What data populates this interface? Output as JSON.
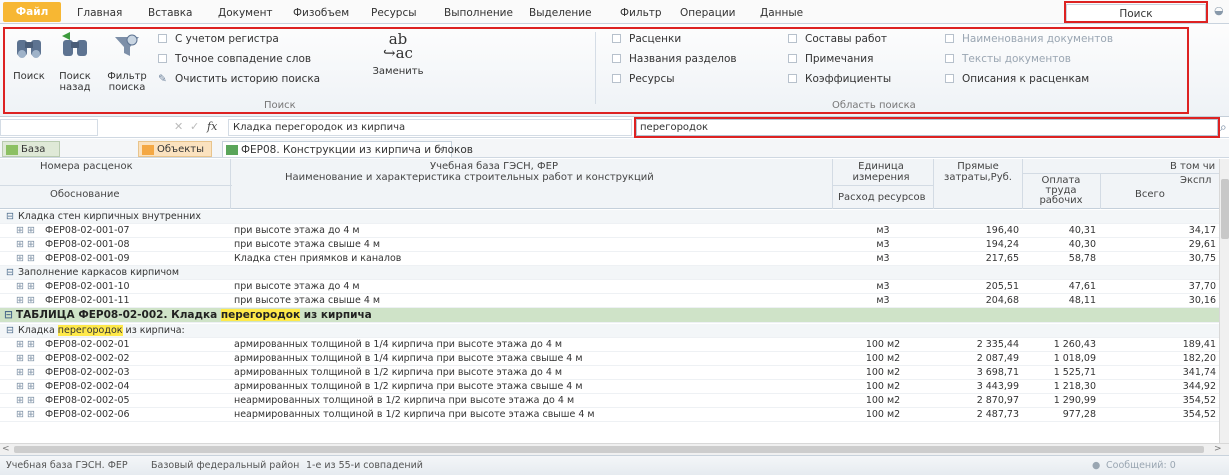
{
  "menu": {
    "file": "Файл",
    "tabs": [
      "Главная",
      "Вставка",
      "Документ",
      "Физобъем",
      "Ресурсы",
      "Выполнение",
      "Выделение",
      "Фильтр",
      "Операции",
      "Данные"
    ],
    "active_tab": "Поиск"
  },
  "ribbon": {
    "search_group": {
      "find_label": "Поиск",
      "find_back_label_1": "Поиск",
      "find_back_label_2": "назад",
      "filter_label_1": "Фильтр",
      "filter_label_2": "поиска",
      "match_case": "С учетом регистра",
      "whole_words": "Точное совпадение слов",
      "clear_history": "Очистить историю поиска",
      "replace_label": "Заменить",
      "group_label": "Поиск"
    },
    "scope_group": {
      "items_col1": [
        "Расценки",
        "Названия разделов",
        "Ресурсы"
      ],
      "items_col2": [
        "Составы работ",
        "Примечания",
        "Коэффициенты"
      ],
      "items_col3": [
        "Наименования документов",
        "Тексты документов",
        "Описания к расценкам"
      ],
      "group_label": "Область поиска"
    }
  },
  "formula": {
    "content": "Кладка перегородок из кирпича",
    "search_value": "перегородок"
  },
  "doc_tabs": {
    "base": "База",
    "objects": "Объекты",
    "document": "ФЕР08. Конструкции из кирпича и блоков"
  },
  "table": {
    "headers": {
      "codes": "Номера расценок",
      "justification": "Обоснование",
      "base": "Учебная база ГЭСН, ФЕР",
      "name": "Наименование и характеристика строительных работ и конструкций",
      "unit_1": "Единица",
      "unit_2": "измерения",
      "consumption": "Расход ресурсов",
      "direct_1": "Прямые",
      "direct_2": "затраты,Руб.",
      "including": "В том чи",
      "labor_1": "Оплата",
      "labor_2": "труда",
      "labor_3": "рабочих",
      "operation": "Экспл",
      "total": "Всего"
    },
    "rows": [
      {
        "kind": "group",
        "text": "Кладка стен кирпичных внутренних"
      },
      {
        "kind": "item",
        "code": "ФЕР08-02-001-07",
        "name": "при высоте этажа до 4 м",
        "unit": "м3",
        "direct": "196,40",
        "labor": "40,31",
        "total": "34,17"
      },
      {
        "kind": "item",
        "code": "ФЕР08-02-001-08",
        "name": "при высоте этажа свыше 4 м",
        "unit": "м3",
        "direct": "194,24",
        "labor": "40,30",
        "total": "29,61"
      },
      {
        "kind": "item",
        "code": "ФЕР08-02-001-09",
        "name": "Кладка стен приямков и каналов",
        "unit": "м3",
        "direct": "217,65",
        "labor": "58,78",
        "total": "30,75"
      },
      {
        "kind": "group",
        "text": "Заполнение каркасов кирпичом"
      },
      {
        "kind": "item",
        "code": "ФЕР08-02-001-10",
        "name": "при высоте этажа до 4 м",
        "unit": "м3",
        "direct": "205,51",
        "labor": "47,61",
        "total": "37,70"
      },
      {
        "kind": "item",
        "code": "ФЕР08-02-001-11",
        "name": "при высоте этажа свыше 4 м",
        "unit": "м3",
        "direct": "204,68",
        "labor": "48,11",
        "total": "30,16"
      },
      {
        "kind": "table",
        "pre": "ТАБЛИЦА ФЕР08-02-002. Кладка ",
        "hit": "перегородок",
        "post": " из кирпича"
      },
      {
        "kind": "group",
        "pre": "Кладка ",
        "hit": "перегородок",
        "post": " из кирпича:"
      },
      {
        "kind": "item",
        "code": "ФЕР08-02-002-01",
        "name": "армированных толщиной в 1/4 кирпича при высоте этажа до 4 м",
        "unit": "100 м2",
        "direct": "2 335,44",
        "labor": "1 260,43",
        "total": "189,41"
      },
      {
        "kind": "item",
        "code": "ФЕР08-02-002-02",
        "name": "армированных толщиной в 1/4 кирпича при высоте этажа свыше 4 м",
        "unit": "100 м2",
        "direct": "2 087,49",
        "labor": "1 018,09",
        "total": "182,20"
      },
      {
        "kind": "item",
        "code": "ФЕР08-02-002-03",
        "name": "армированных толщиной в 1/2 кирпича при высоте этажа до 4 м",
        "unit": "100 м2",
        "direct": "3 698,71",
        "labor": "1 525,71",
        "total": "341,74"
      },
      {
        "kind": "item",
        "code": "ФЕР08-02-002-04",
        "name": "армированных толщиной в 1/2 кирпича при высоте этажа свыше 4 м",
        "unit": "100 м2",
        "direct": "3 443,99",
        "labor": "1 218,30",
        "total": "344,92"
      },
      {
        "kind": "item",
        "code": "ФЕР08-02-002-05",
        "name": "неармированных толщиной в 1/2 кирпича при высоте этажа до 4 м",
        "unit": "100 м2",
        "direct": "2 870,97",
        "labor": "1 290,99",
        "total": "354,52"
      },
      {
        "kind": "item",
        "code": "ФЕР08-02-002-06",
        "name": "неармированных толщиной в 1/2 кирпича при высоте этажа свыше 4 м",
        "unit": "100 м2",
        "direct": "2 487,73",
        "labor": "977,28",
        "total": "354,52"
      }
    ]
  },
  "status": {
    "base": "Учебная база ГЭСН. ФЕР",
    "region": "Базовый федеральный район",
    "matches": "1-е из 55-и совпадений",
    "messages": "Сообщений: 0"
  },
  "colors": {
    "accent": "#f7b733",
    "highlight": "#ffe94a",
    "table_row": "#cfe3c8",
    "frame": "#d22222"
  }
}
